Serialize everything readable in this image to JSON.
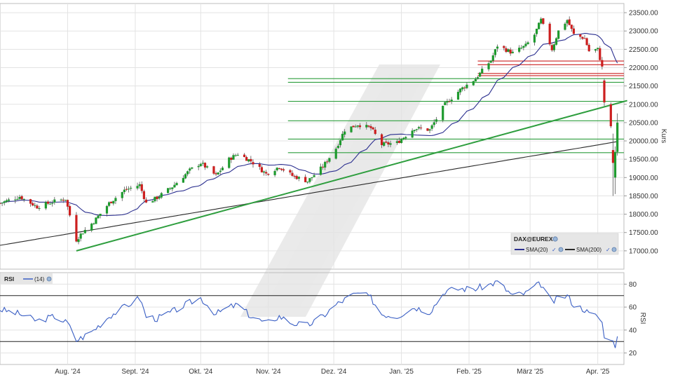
{
  "chart_data": [
    {
      "type": "candlestick",
      "instrument": "DAX@EUREX",
      "ylabel": "Kurs",
      "ylim": [
        16500,
        23750
      ],
      "y_ticks": [
        17000,
        17500,
        18000,
        18500,
        19000,
        19500,
        20000,
        20500,
        21000,
        21500,
        22000,
        22500,
        23000,
        23500
      ],
      "y_tick_labels": [
        "17000.00",
        "17500.00",
        "18000.00",
        "18500.00",
        "19000.00",
        "19500.00",
        "20000.00",
        "20500.00",
        "21000.00",
        "21500.00",
        "22000.00",
        "22500.00",
        "23000.00",
        "23500.00"
      ],
      "x_ticks": [
        {
          "label": "Aug. '24",
          "date": "2024-08-01"
        },
        {
          "label": "Sept. '24",
          "date": "2024-09-01"
        },
        {
          "label": "Okt. '24",
          "date": "2024-10-01"
        },
        {
          "label": "Nov. '24",
          "date": "2024-11-01"
        },
        {
          "label": "Dez. '24",
          "date": "2024-12-01"
        },
        {
          "label": "Jan. '25",
          "date": "2025-01-01"
        },
        {
          "label": "Feb. '25",
          "date": "2025-02-01"
        },
        {
          "label": "März '25",
          "date": "2025-03-01"
        },
        {
          "label": "Apr. '25",
          "date": "2025-04-01"
        }
      ],
      "legend": {
        "title": "DAX@EUREX",
        "position": "bottom-right",
        "items": [
          {
            "label": "SMA(20)",
            "color": "#2b2f8f"
          },
          {
            "label": "SMA(200)",
            "color": "#2b2b2b"
          }
        ]
      },
      "price_keypoints": [
        [
          "2024-07-01",
          18300
        ],
        [
          "2024-07-10",
          18480
        ],
        [
          "2024-07-18",
          18200
        ],
        [
          "2024-07-26",
          18350
        ],
        [
          "2024-07-31",
          18420
        ],
        [
          "2024-08-05",
          17300
        ],
        [
          "2024-08-07",
          17450
        ],
        [
          "2024-08-13",
          17800
        ],
        [
          "2024-08-20",
          18300
        ],
        [
          "2024-08-27",
          18650
        ],
        [
          "2024-09-03",
          18800
        ],
        [
          "2024-09-06",
          18300
        ],
        [
          "2024-09-11",
          18450
        ],
        [
          "2024-09-18",
          18750
        ],
        [
          "2024-09-26",
          19200
        ],
        [
          "2024-10-01",
          19400
        ],
        [
          "2024-10-08",
          19050
        ],
        [
          "2024-10-14",
          19500
        ],
        [
          "2024-10-18",
          19650
        ],
        [
          "2024-10-24",
          19450
        ],
        [
          "2024-10-31",
          19100
        ],
        [
          "2024-11-06",
          19300
        ],
        [
          "2024-11-12",
          19050
        ],
        [
          "2024-11-19",
          18900
        ],
        [
          "2024-11-26",
          19300
        ],
        [
          "2024-12-02",
          19800
        ],
        [
          "2024-12-06",
          20300
        ],
        [
          "2024-12-12",
          20450
        ],
        [
          "2024-12-18",
          20350
        ],
        [
          "2024-12-23",
          19900
        ],
        [
          "2024-12-30",
          19950
        ],
        [
          "2025-01-07",
          20350
        ],
        [
          "2025-01-14",
          20300
        ],
        [
          "2025-01-21",
          21000
        ],
        [
          "2025-01-28",
          21400
        ],
        [
          "2025-02-04",
          21700
        ],
        [
          "2025-02-11",
          22200
        ],
        [
          "2025-02-14",
          22600
        ],
        [
          "2025-02-21",
          22400
        ],
        [
          "2025-02-27",
          22600
        ],
        [
          "2025-03-03",
          22900
        ],
        [
          "2025-03-06",
          23300
        ],
        [
          "2025-03-11",
          22500
        ],
        [
          "2025-03-14",
          23000
        ],
        [
          "2025-03-18",
          23300
        ],
        [
          "2025-03-21",
          22900
        ],
        [
          "2025-03-26",
          22800
        ],
        [
          "2025-03-28",
          22450
        ],
        [
          "2025-04-01",
          22500
        ],
        [
          "2025-04-03",
          22000
        ],
        [
          "2025-04-04",
          20700
        ],
        [
          "2025-04-07",
          20200
        ],
        [
          "2025-04-08",
          20350
        ],
        [
          "2025-04-09",
          19700
        ],
        [
          "2025-04-10",
          20500
        ]
      ],
      "trendline": {
        "start": [
          "2024-08-05",
          17000
        ],
        "end": [
          "2025-04-10",
          21100
        ],
        "color": "#2e9e3e"
      },
      "support_levels": [
        {
          "value": 19680,
          "color": "#2e9e3e"
        },
        {
          "value": 20050,
          "color": "#2e9e3e"
        },
        {
          "value": 20550,
          "color": "#2e9e3e"
        },
        {
          "value": 21080,
          "color": "#2e9e3e"
        },
        {
          "value": 21600,
          "color": "#2e9e3e"
        },
        {
          "value": 21700,
          "color": "#2e9e3e"
        }
      ],
      "resistance_levels": [
        {
          "value": 21780,
          "color": "#cc2222"
        },
        {
          "value": 21840,
          "color": "#cc2222"
        },
        {
          "value": 22080,
          "color": "#cc2222"
        },
        {
          "value": 22180,
          "color": "#cc2222"
        }
      ],
      "colors": {
        "up": "#1e9a2e",
        "down": "#cc1f1f",
        "wick": "#555555"
      }
    },
    {
      "type": "line",
      "indicator": "RSI",
      "period_label": "(14)",
      "title": "RSI",
      "ylabel": "RSI",
      "ylim": [
        10,
        90
      ],
      "y_ticks": [
        20,
        40,
        60,
        80
      ],
      "y_tick_labels": [
        "20",
        "40",
        "60",
        "80"
      ],
      "reference_lines": [
        30,
        70
      ],
      "color": "#3a5fc4",
      "keypoints": [
        [
          "2024-07-01",
          58
        ],
        [
          "2024-07-10",
          54
        ],
        [
          "2024-07-18",
          48
        ],
        [
          "2024-07-26",
          52
        ],
        [
          "2024-08-01",
          46
        ],
        [
          "2024-08-05",
          31
        ],
        [
          "2024-08-08",
          34
        ],
        [
          "2024-08-13",
          40
        ],
        [
          "2024-08-20",
          52
        ],
        [
          "2024-08-27",
          60
        ],
        [
          "2024-09-03",
          68
        ],
        [
          "2024-09-06",
          52
        ],
        [
          "2024-09-11",
          50
        ],
        [
          "2024-09-18",
          56
        ],
        [
          "2024-09-26",
          64
        ],
        [
          "2024-10-01",
          68
        ],
        [
          "2024-10-08",
          54
        ],
        [
          "2024-10-14",
          60
        ],
        [
          "2024-10-18",
          62
        ],
        [
          "2024-10-24",
          52
        ],
        [
          "2024-10-31",
          46
        ],
        [
          "2024-11-06",
          52
        ],
        [
          "2024-11-12",
          46
        ],
        [
          "2024-11-19",
          44
        ],
        [
          "2024-11-26",
          52
        ],
        [
          "2024-12-02",
          62
        ],
        [
          "2024-12-09",
          70
        ],
        [
          "2024-12-13",
          72
        ],
        [
          "2024-12-18",
          68
        ],
        [
          "2024-12-23",
          54
        ],
        [
          "2024-12-30",
          52
        ],
        [
          "2025-01-07",
          60
        ],
        [
          "2025-01-14",
          56
        ],
        [
          "2025-01-21",
          74
        ],
        [
          "2025-01-28",
          76
        ],
        [
          "2025-02-04",
          76
        ],
        [
          "2025-02-11",
          80
        ],
        [
          "2025-02-14",
          82
        ],
        [
          "2025-02-21",
          70
        ],
        [
          "2025-02-27",
          72
        ],
        [
          "2025-03-03",
          78
        ],
        [
          "2025-03-06",
          80
        ],
        [
          "2025-03-11",
          64
        ],
        [
          "2025-03-14",
          68
        ],
        [
          "2025-03-18",
          70
        ],
        [
          "2025-03-21",
          62
        ],
        [
          "2025-03-26",
          58
        ],
        [
          "2025-03-28",
          54
        ],
        [
          "2025-04-01",
          52
        ],
        [
          "2025-04-03",
          46
        ],
        [
          "2025-04-04",
          36
        ],
        [
          "2025-04-07",
          30
        ],
        [
          "2025-04-08",
          33
        ],
        [
          "2025-04-09",
          27
        ],
        [
          "2025-04-10",
          33
        ]
      ]
    }
  ]
}
